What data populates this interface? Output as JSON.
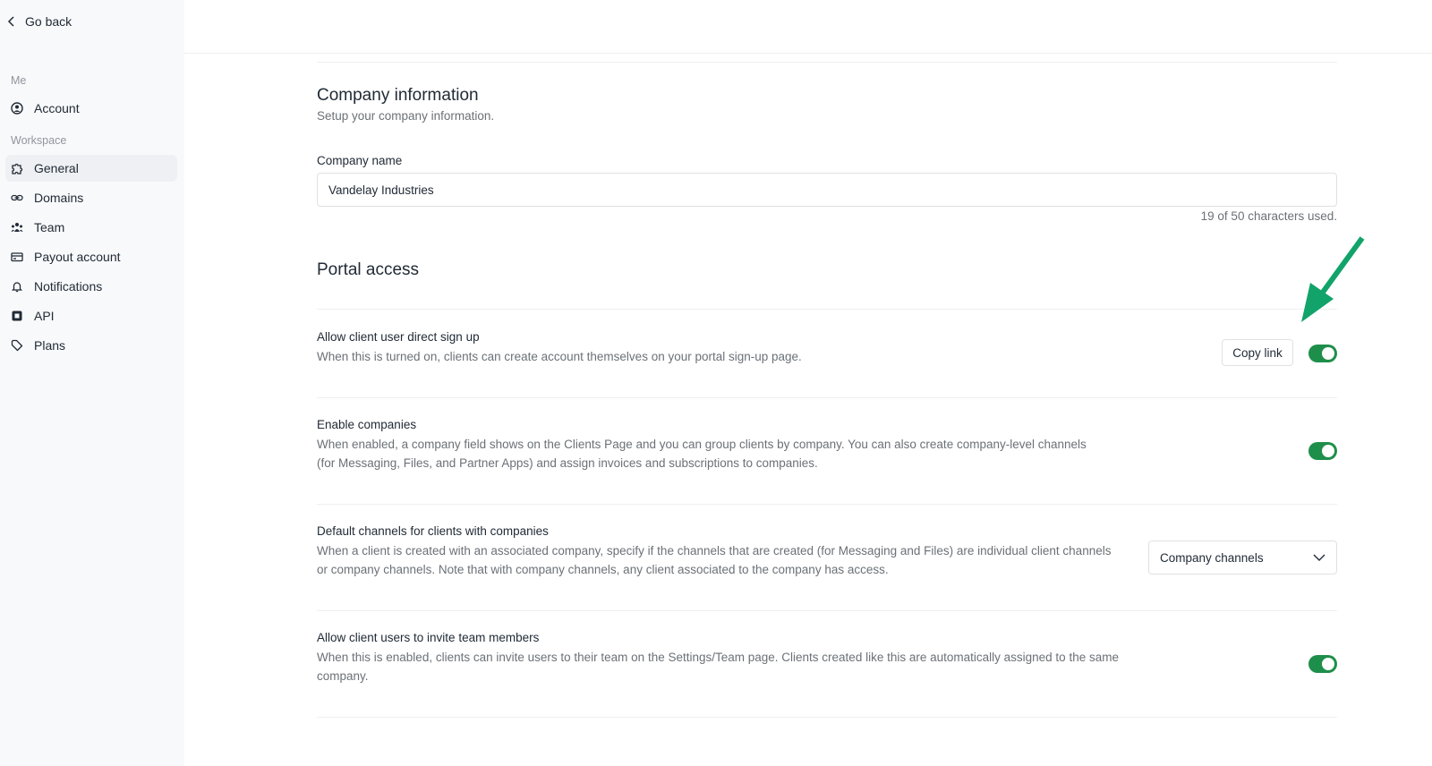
{
  "sidebar": {
    "go_back": "Go back",
    "sections": [
      {
        "label": "Me"
      },
      {
        "label": "Workspace"
      }
    ],
    "items": [
      {
        "label": "Account",
        "icon": "user-circle-icon",
        "active": false
      },
      {
        "label": "General",
        "icon": "puzzle-icon",
        "active": true
      },
      {
        "label": "Domains",
        "icon": "link-icon",
        "active": false
      },
      {
        "label": "Team",
        "icon": "team-icon",
        "active": false
      },
      {
        "label": "Payout account",
        "icon": "credit-card-icon",
        "active": false
      },
      {
        "label": "Notifications",
        "icon": "bell-icon",
        "active": false
      },
      {
        "label": "API",
        "icon": "chip-icon",
        "active": false
      },
      {
        "label": "Plans",
        "icon": "tag-icon",
        "active": false
      }
    ]
  },
  "company_info": {
    "title": "Company information",
    "subtitle": "Setup your company information.",
    "field_label": "Company name",
    "field_value": "Vandelay Industries",
    "char_count": "19 of 50 characters used."
  },
  "portal_access": {
    "title": "Portal access",
    "settings": [
      {
        "title": "Allow client user direct sign up",
        "description": "When this is turned on, clients can create account themselves on your portal sign-up page.",
        "control": "toggle",
        "enabled": true,
        "button_label": "Copy link"
      },
      {
        "title": "Enable companies",
        "description": "When enabled, a company field shows on the Clients Page and you can group clients by company. You can also create company-level channels (for Messaging, Files, and Partner Apps) and assign invoices and subscriptions to companies.",
        "control": "toggle",
        "enabled": true
      },
      {
        "title": "Default channels for clients with companies",
        "description": "When a client is created with an associated company, specify if the channels that are created (for Messaging and Files) are individual client channels or company channels. Note that with company channels, any client associated to the company has access.",
        "control": "select",
        "selected": "Company channels"
      },
      {
        "title": "Allow client users to invite team members",
        "description": "When this is enabled, clients can invite users to their team on the Settings/Team page. Clients created like this are automatically assigned to the same company.",
        "control": "toggle",
        "enabled": true
      }
    ]
  },
  "colors": {
    "toggle_on": "#1e8f4b",
    "annotation_arrow": "#12a36a"
  }
}
